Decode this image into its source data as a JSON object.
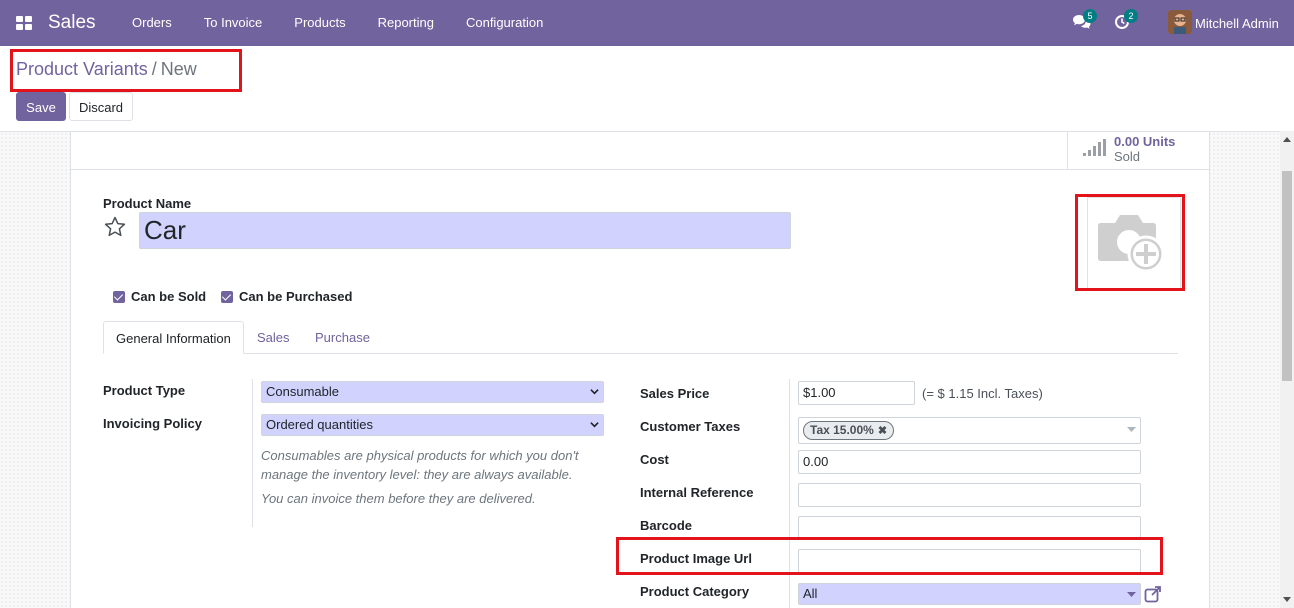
{
  "navbar": {
    "app_name": "Sales",
    "menu": [
      "Orders",
      "To Invoice",
      "Products",
      "Reporting",
      "Configuration"
    ],
    "messages_count": "5",
    "activities_count": "2",
    "user_name": "Mitchell Admin",
    "color": "#71639e"
  },
  "breadcrumb": {
    "parent": "Product Variants",
    "separator": "/",
    "current": "New"
  },
  "buttons": {
    "save": "Save",
    "discard": "Discard"
  },
  "stat_button": {
    "value": "0.00 Units",
    "label": "Sold"
  },
  "form": {
    "product_name_label": "Product Name",
    "product_name": "Car",
    "can_be_sold": "Can be Sold",
    "can_be_purchased": "Can be Purchased",
    "tabs": [
      "General Information",
      "Sales",
      "Purchase"
    ],
    "left": {
      "product_type_label": "Product Type",
      "product_type": "Consumable",
      "invoicing_policy_label": "Invoicing Policy",
      "invoicing_policy": "Ordered quantities",
      "help1": "Consumables are physical products for which you don't manage the inventory level: they are always available.",
      "help2": "You can invoice them before they are delivered."
    },
    "right": {
      "sales_price_label": "Sales Price",
      "sales_price": "$1.00",
      "incl_taxes": "(= $ 1.15 Incl. Taxes)",
      "customer_taxes_label": "Customer Taxes",
      "tax_tag": "Tax 15.00%",
      "cost_label": "Cost",
      "cost": "0.00",
      "internal_reference_label": "Internal Reference",
      "internal_reference": "",
      "barcode_label": "Barcode",
      "barcode": "",
      "product_image_url_label": "Product Image Url",
      "product_image_url": "",
      "product_category_label": "Product Category",
      "product_category": "All"
    }
  }
}
